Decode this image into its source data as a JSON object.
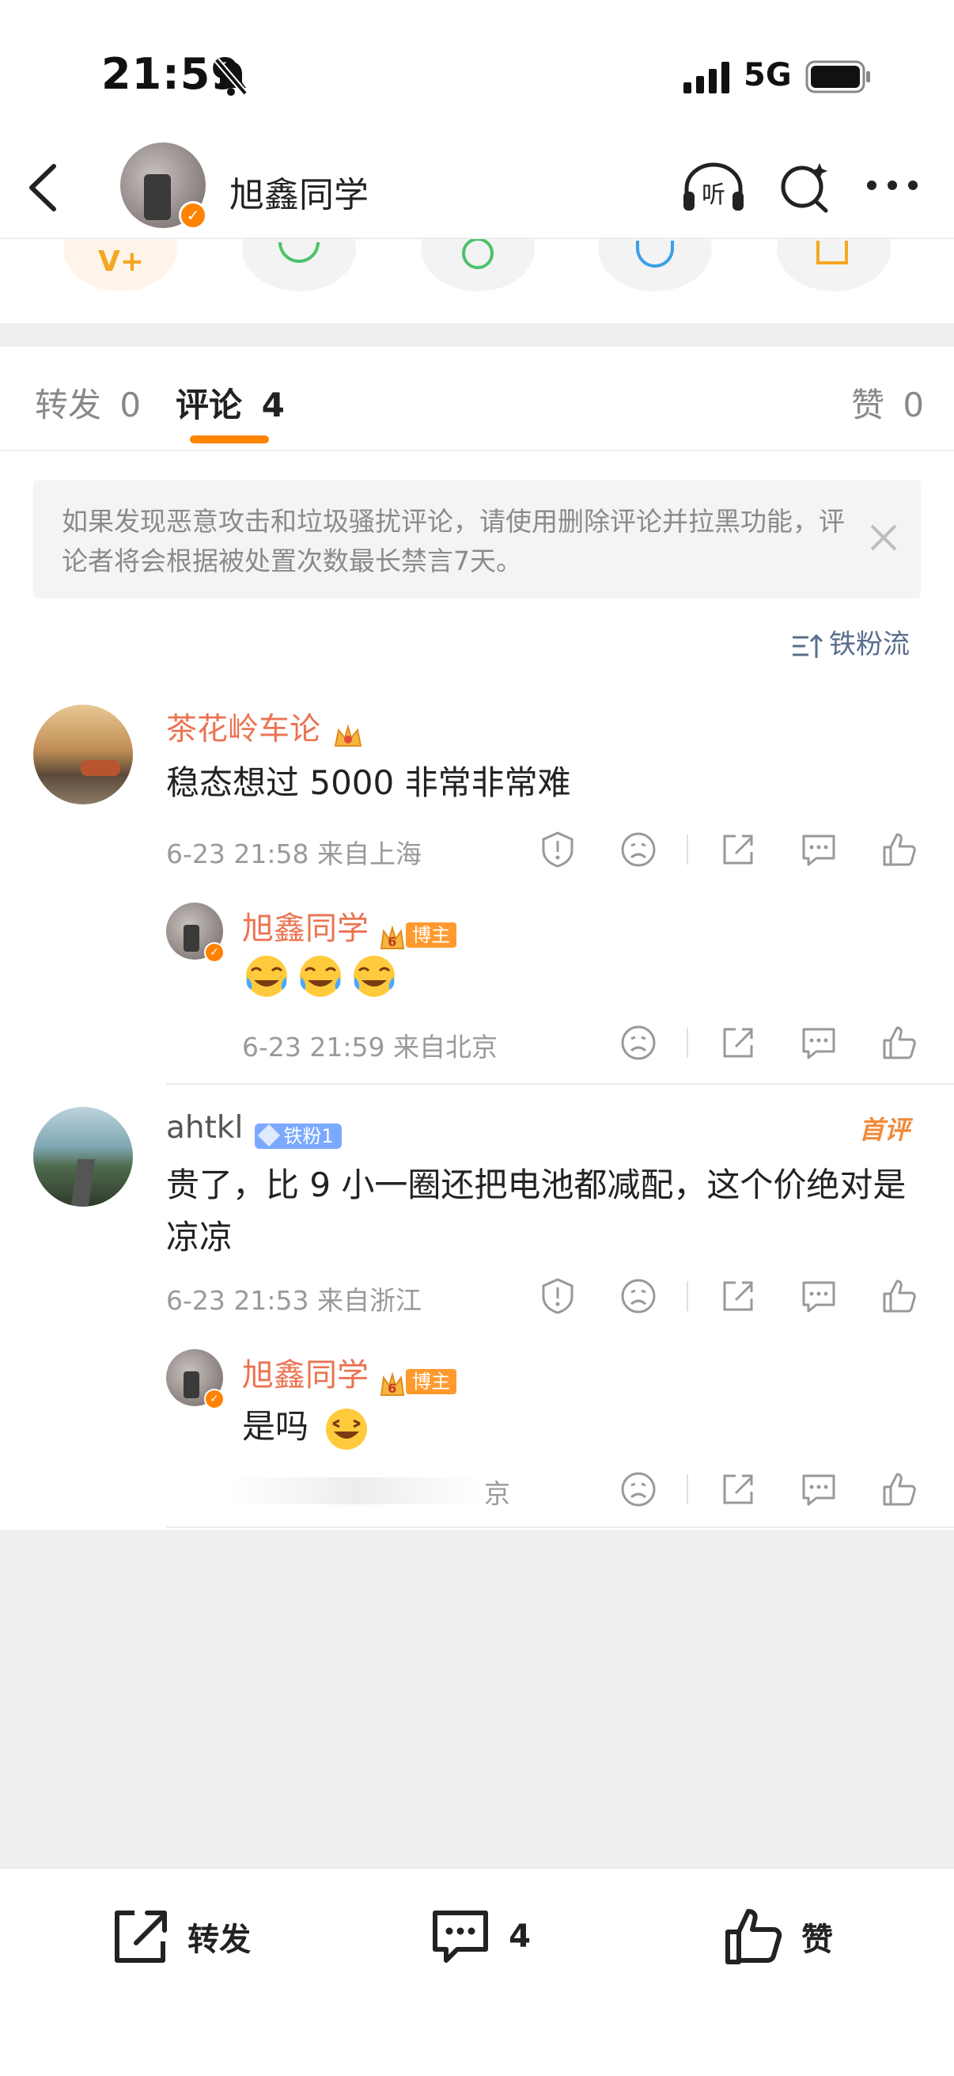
{
  "status_bar": {
    "time": "21:59",
    "network": "5G"
  },
  "header": {
    "title": "旭鑫同学"
  },
  "tabs": [
    {
      "label": "转发",
      "count": "0"
    },
    {
      "label": "评论",
      "count": "4"
    },
    {
      "label": "赞",
      "count": "0"
    }
  ],
  "notice": {
    "text": "如果发现恶意攻击和垃圾骚扰评论，请使用删除评论并拉黑功能，评论者将会根据被处置次数最长禁言7天。"
  },
  "sort": {
    "label": "铁粉流"
  },
  "comments": [
    {
      "user": "茶花岭车论",
      "text": "稳态想过 5000 非常非常难",
      "meta": "6-23 21:58  来自上海",
      "reply": {
        "user": "旭鑫同学",
        "badge_level": "6",
        "badge": "博主",
        "text": "",
        "meta": "6-23 21:59  来自北京"
      }
    },
    {
      "user": "ahtkl",
      "fan_badge": "铁粉1",
      "tag": "首评",
      "text": "贵了，比 9 小一圈还把电池都减配，这个价绝对是凉凉",
      "meta": "6-23 21:53  来自浙江",
      "reply": {
        "user": "旭鑫同学",
        "badge_level": "6",
        "badge": "博主",
        "text": "是吗",
        "meta": "京"
      }
    }
  ],
  "toolbar": {
    "repost": "转发",
    "comment_count": "4",
    "like": "赞"
  },
  "colors": {
    "accent": "#ff8200",
    "username": "#eb7350",
    "link_blue": "#5a6e8d"
  }
}
